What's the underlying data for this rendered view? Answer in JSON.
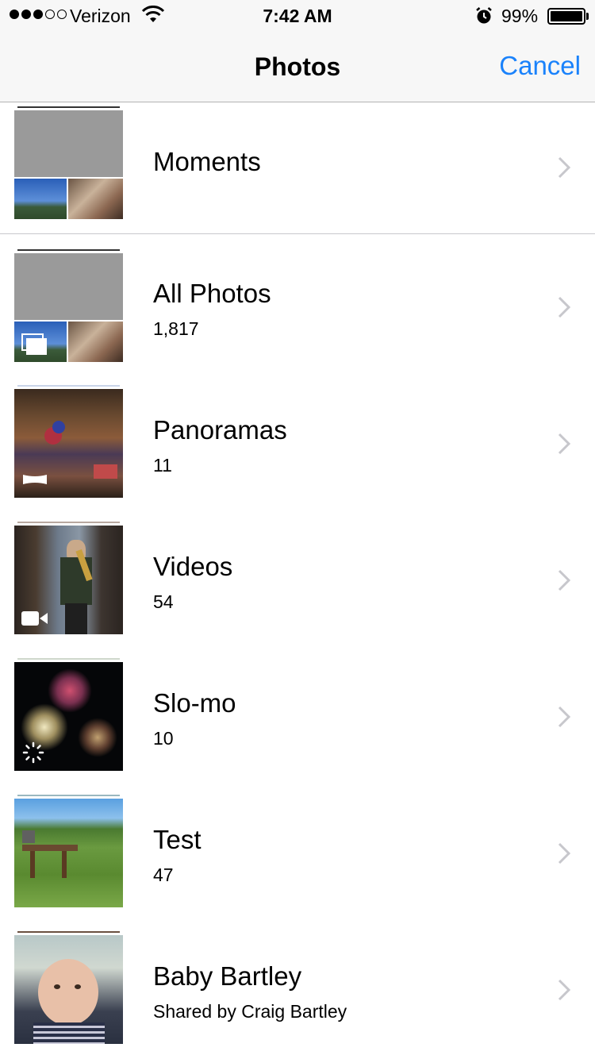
{
  "status_bar": {
    "carrier": "Verizon",
    "time": "7:42 AM",
    "battery": "99%",
    "signal_bars": 3,
    "signal_total": 5
  },
  "nav": {
    "title": "Photos",
    "cancel_label": "Cancel",
    "accent_color": "#1a82fb"
  },
  "albums": [
    {
      "title": "Moments",
      "count": "",
      "icon": "moments-thumbnail"
    },
    {
      "title": "All Photos",
      "count": "1,817",
      "icon": "all-photos-thumbnail"
    },
    {
      "title": "Panoramas",
      "count": "11",
      "icon": "panorama-icon"
    },
    {
      "title": "Videos",
      "count": "54",
      "icon": "video-camera-icon"
    },
    {
      "title": "Slo-mo",
      "count": "10",
      "icon": "slo-mo-icon"
    },
    {
      "title": "Test",
      "count": "47",
      "icon": "album-thumbnail"
    },
    {
      "title": "Baby Bartley",
      "count": "Shared by Craig Bartley",
      "icon": "shared-album-thumbnail"
    }
  ]
}
